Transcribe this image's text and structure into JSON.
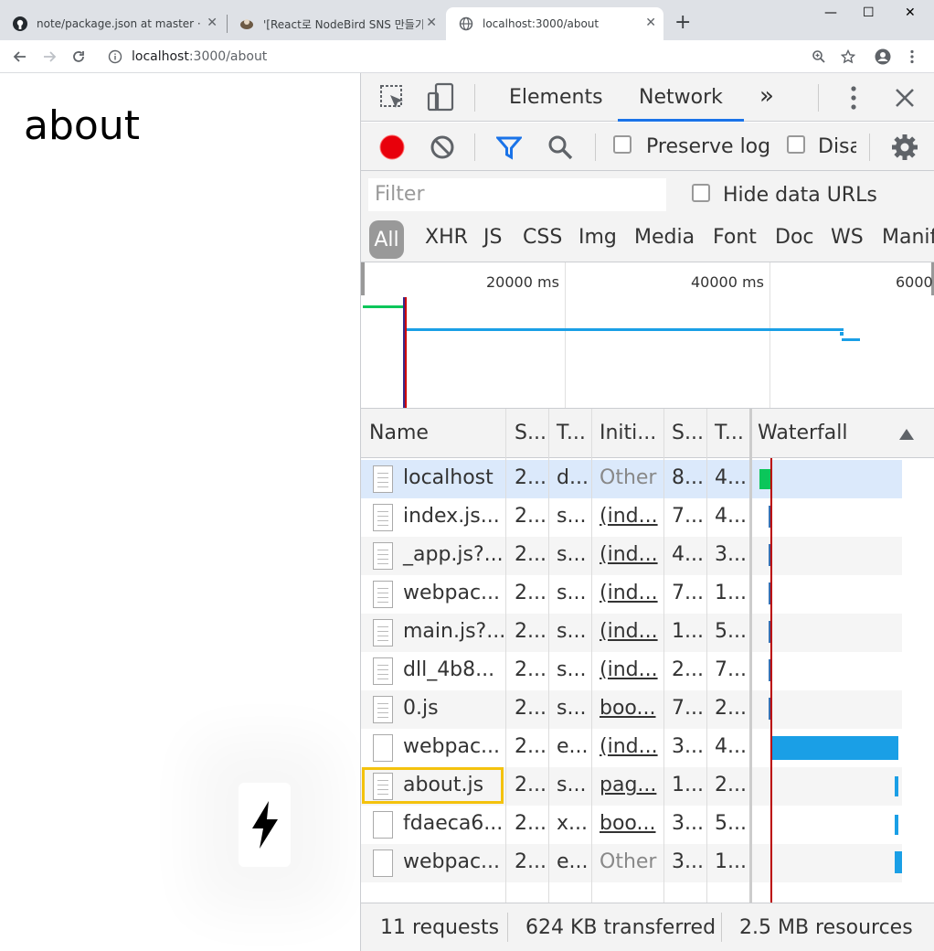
{
  "browser": {
    "tabs": [
      {
        "title": "note/package.json at master · p"
      },
      {
        "title": "'[React로 NodeBird SNS 만들기]"
      },
      {
        "title": "localhost:3000/about"
      }
    ],
    "new_tab": "+",
    "window_controls": {
      "minimize": "—",
      "maximize": "☐",
      "close": "✕"
    },
    "address": {
      "host": "localhost",
      "path": ":3000/about"
    }
  },
  "page": {
    "heading": "about",
    "icon": "lightning-bolt-icon"
  },
  "devtools": {
    "tabs": [
      "Elements",
      "Network"
    ],
    "more": "»",
    "toolbar": {
      "preserve_log": "Preserve log",
      "disable_cache": "Disa"
    },
    "filter": {
      "placeholder": "Filter",
      "hide_data_urls": "Hide data URLs",
      "types": [
        "All",
        "XHR",
        "JS",
        "CSS",
        "Img",
        "Media",
        "Font",
        "Doc",
        "WS",
        "Manif"
      ]
    },
    "overview": {
      "ticks": [
        "20000 ms",
        "40000 ms",
        "6000"
      ]
    },
    "columns": [
      "Name",
      "S...",
      "T...",
      "Initi...",
      "S...",
      "T...",
      "Waterfall"
    ],
    "rows": [
      {
        "name": "localhost",
        "status": "2...",
        "type": "d...",
        "initiator": "Other",
        "size": "8...",
        "time": "4..."
      },
      {
        "name": "index.js...",
        "status": "2...",
        "type": "s...",
        "initiator": "(ind...",
        "size": "7...",
        "time": "4..."
      },
      {
        "name": "_app.js?...",
        "status": "2...",
        "type": "s...",
        "initiator": "(ind...",
        "size": "4...",
        "time": "3..."
      },
      {
        "name": "webpac...",
        "status": "2...",
        "type": "s...",
        "initiator": "(ind...",
        "size": "7...",
        "time": "1..."
      },
      {
        "name": "main.js?...",
        "status": "2...",
        "type": "s...",
        "initiator": "(ind...",
        "size": "1...",
        "time": "5..."
      },
      {
        "name": "dll_4b8...",
        "status": "2...",
        "type": "s...",
        "initiator": "(ind...",
        "size": "2...",
        "time": "7..."
      },
      {
        "name": "0.js",
        "status": "2...",
        "type": "s...",
        "initiator": "boo...",
        "size": "7...",
        "time": "2..."
      },
      {
        "name": "webpac...",
        "status": "2...",
        "type": "e...",
        "initiator": "(ind...",
        "size": "3...",
        "time": "4..."
      },
      {
        "name": "about.js",
        "status": "2...",
        "type": "s...",
        "initiator": "pag...",
        "size": "1...",
        "time": "2..."
      },
      {
        "name": "fdaeca6...",
        "status": "2...",
        "type": "x...",
        "initiator": "boo...",
        "size": "3...",
        "time": "5..."
      },
      {
        "name": "webpac...",
        "status": "2...",
        "type": "e...",
        "initiator": "Other",
        "size": "3...",
        "time": "1..."
      }
    ],
    "status_bar": {
      "requests": "11 requests",
      "transferred": "624 KB transferred",
      "resources": "2.5 MB resources"
    },
    "colors": {
      "accent": "#1a73e8",
      "record": "#e8000b",
      "bar_blue": "#1a9fe6",
      "bar_green": "#0bc65a",
      "highlight": "#f4c20d"
    }
  }
}
